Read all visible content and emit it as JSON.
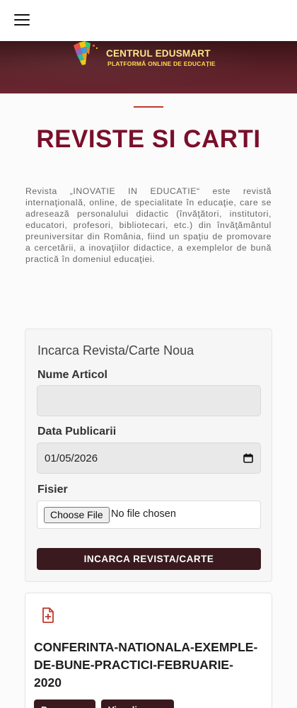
{
  "header": {
    "brand_title": "CENTRUL EDUSMART",
    "brand_subtitle": "PLATFORMĂ ONLINE DE EDUCAȚIE"
  },
  "page": {
    "title": "REVISTE SI CARTI",
    "intro": "Revista „INOVATIE IN EDUCATIE“ este revistă internaţională, online, de specialitate în educaţie, care se adresează personalului didactic (învăţători, institutori, educatori, profesori, bibliotecari, etc.) din învăţământul preuniversitar din România, fiind un spaţiu de promovare a cercetării, a inovaţiilor didactice, a exemplelor de bună practică în domeniul educaţiei."
  },
  "upload_form": {
    "heading": "Incarca Revista/Carte Noua",
    "name_label": "Nume Articol",
    "name_value": "",
    "date_label": "Data Publicarii",
    "date_value": "01/05/2026",
    "file_label": "Fisier",
    "choose_file_label": "Choose File",
    "file_status": "No file chosen",
    "submit_label": "INCARCA REVISTA/CARTE"
  },
  "documents": [
    {
      "title": "CONFERINTA-NATIONALA-EXEMPLE-DE-BUNE-PRACTICI-FEBRUARIE-2020",
      "buttons": [
        "Descarca",
        "Vizualizeaza"
      ]
    }
  ],
  "colors": {
    "title": "#7a0f2a",
    "accent_divider": "#c0392b",
    "button_bg": "#3a1a1f",
    "banner_bg": "#5b1f27",
    "brand_text": "#ffe58a",
    "doc_icon": "#c0392b"
  },
  "icons": {
    "menu": "hamburger-icon",
    "calendar": "calendar-icon",
    "document": "file-plus-icon",
    "logo": "edusmart-logo"
  }
}
